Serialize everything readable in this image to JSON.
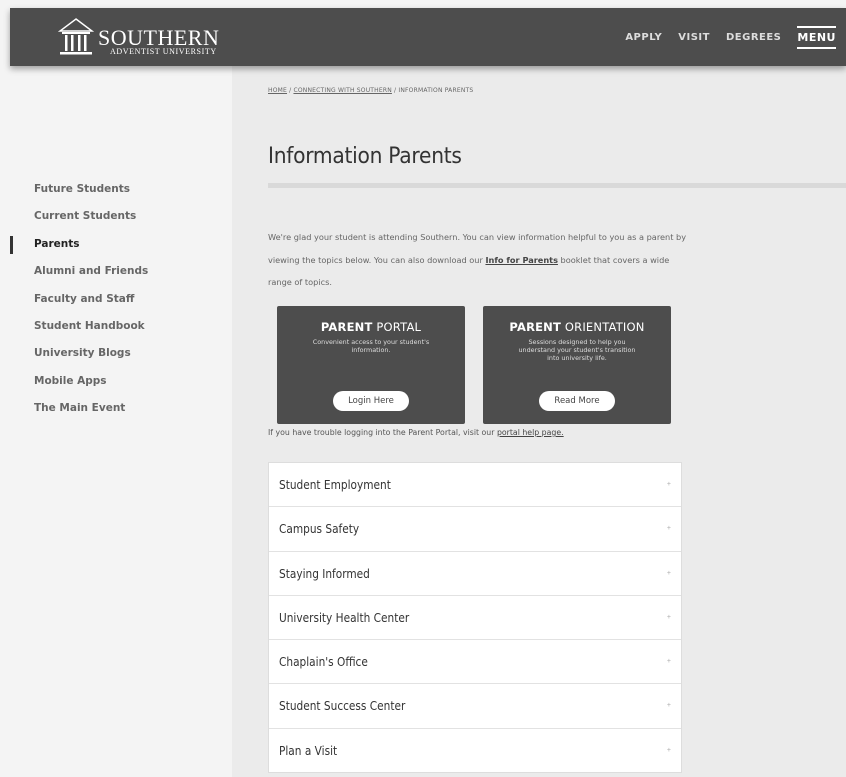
{
  "header": {
    "logo_name": "SOUTHERN",
    "logo_sub": "ADVENTIST UNIVERSITY",
    "nav": [
      "APPLY",
      "VISIT",
      "DEGREES",
      "MENU"
    ]
  },
  "breadcrumb": {
    "home": "HOME",
    "sep1": " / ",
    "section": "CONNECTING WITH SOUTHERN",
    "sep2": " / ",
    "current": "INFORMATION PARENTS"
  },
  "sidebar": {
    "items": [
      {
        "label": "Future Students"
      },
      {
        "label": "Current Students"
      },
      {
        "label": "Parents"
      },
      {
        "label": "Alumni and Friends"
      },
      {
        "label": "Faculty and Staff"
      },
      {
        "label": "Student Handbook"
      },
      {
        "label": "University Blogs"
      },
      {
        "label": "Mobile Apps"
      },
      {
        "label": "The Main Event"
      }
    ]
  },
  "main": {
    "title": "Information Parents",
    "intro_a": "We're glad your student is attending Southern. You can view information helpful to you as a parent by viewing the topics below. You can also download our ",
    "intro_link": "Info for Parents",
    "intro_b": " booklet that covers a wide range of topics.",
    "cards": [
      {
        "title_bold": "PARENT",
        "title_light": " PORTAL",
        "desc": "Convenient access to your student's information.",
        "button": "Login Here"
      },
      {
        "title_bold": "PARENT",
        "title_light": " ORIENTATION",
        "desc": "Sessions designed to help you understand your student's transition into university life.",
        "button": "Read More"
      }
    ],
    "help_a": "If you have trouble logging into the Parent Portal, visit our ",
    "help_link": "portal help page.",
    "accordion": [
      {
        "label": "Student Employment",
        "icon": "+"
      },
      {
        "label": "Campus Safety",
        "icon": "+"
      },
      {
        "label": "Staying Informed",
        "icon": "+"
      },
      {
        "label": "University Health Center",
        "icon": "+"
      },
      {
        "label": "Chaplain's Office",
        "icon": "+"
      },
      {
        "label": "Student Success Center",
        "icon": "+"
      },
      {
        "label": "Plan a Visit",
        "icon": "+"
      }
    ]
  }
}
